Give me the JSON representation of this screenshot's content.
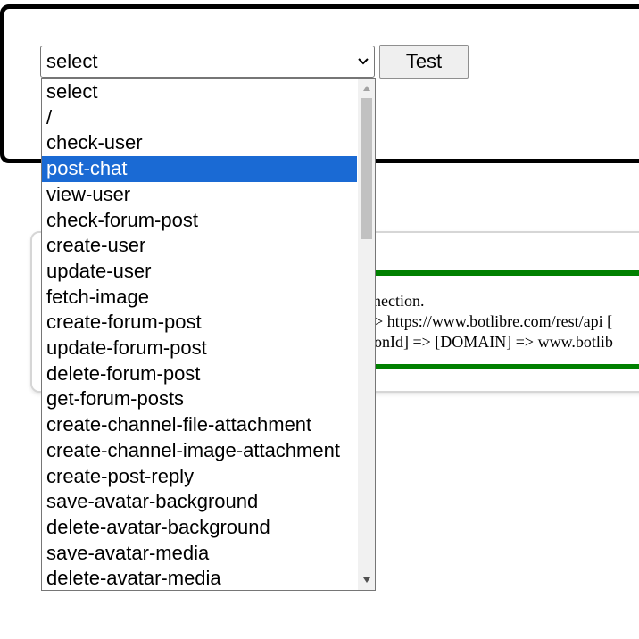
{
  "form": {
    "select_value": "select",
    "test_button": "Test"
  },
  "result": {
    "line1": "nnection.",
    "line2": "=> https://www.botlibre.com/rest/api [",
    "line3": "tionId] => [DOMAIN] => www.botlib"
  },
  "dropdown": {
    "options": [
      "select",
      "/",
      "check-user",
      "post-chat",
      "view-user",
      "check-forum-post",
      "create-user",
      "update-user",
      "fetch-image",
      "create-forum-post",
      "update-forum-post",
      "delete-forum-post",
      "get-forum-posts",
      "create-channel-file-attachment",
      "create-channel-image-attachment",
      "create-post-reply",
      "save-avatar-background",
      "delete-avatar-background",
      "save-avatar-media",
      "delete-avatar-media"
    ],
    "selected_index": 3
  },
  "colors": {
    "highlight": "#1a6ad4",
    "green_rule": "#008000"
  }
}
